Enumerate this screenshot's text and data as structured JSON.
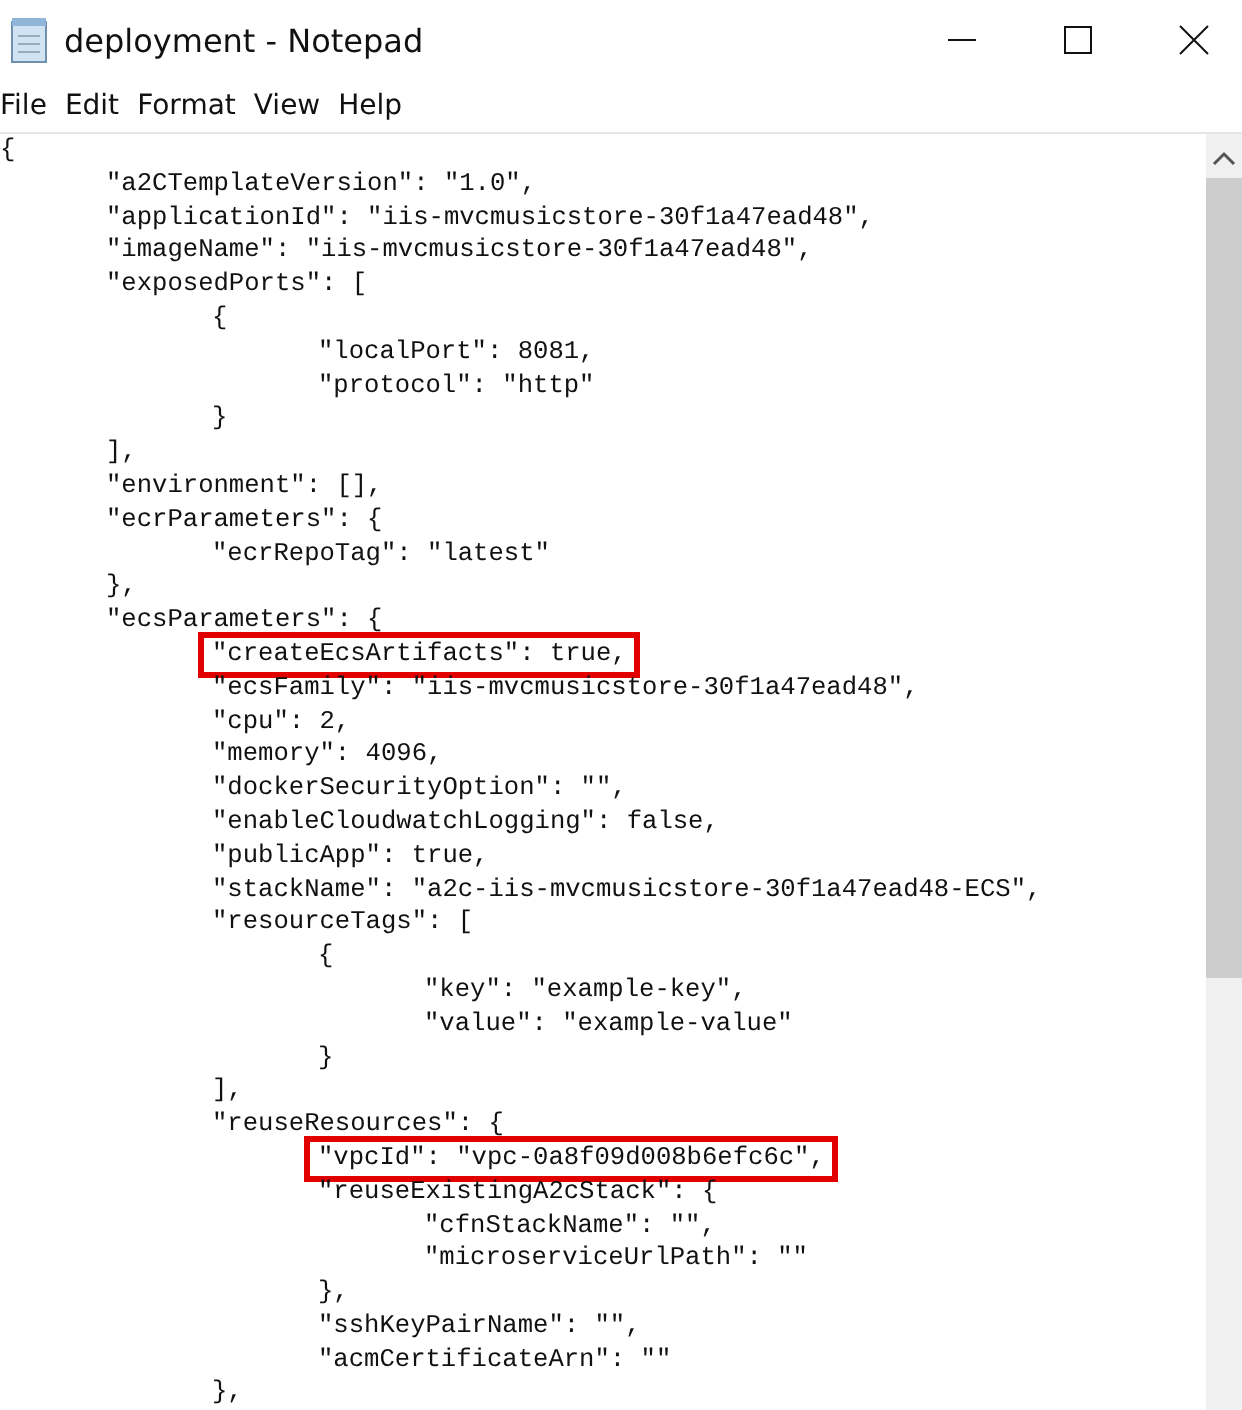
{
  "window": {
    "title": "deployment - Notepad"
  },
  "menu": [
    "File",
    "Edit",
    "Format",
    "View",
    "Help"
  ],
  "lines": [
    {
      "text": "{",
      "highlighted": false
    },
    {
      "text": "\t\"a2CTemplateVersion\": \"1.0\",",
      "highlighted": false
    },
    {
      "text": "\t\"applicationId\": \"iis-mvcmusicstore-30f1a47ead48\",",
      "highlighted": false
    },
    {
      "text": "\t\"imageName\": \"iis-mvcmusicstore-30f1a47ead48\",",
      "highlighted": false
    },
    {
      "text": "\t\"exposedPorts\": [",
      "highlighted": false
    },
    {
      "text": "\t\t{",
      "highlighted": false
    },
    {
      "text": "\t\t\t\"localPort\": 8081,",
      "highlighted": false
    },
    {
      "text": "\t\t\t\"protocol\": \"http\"",
      "highlighted": false
    },
    {
      "text": "\t\t}",
      "highlighted": false
    },
    {
      "text": "\t],",
      "highlighted": false
    },
    {
      "text": "\t\"environment\": [],",
      "highlighted": false
    },
    {
      "text": "\t\"ecrParameters\": {",
      "highlighted": false
    },
    {
      "text": "\t\t\"ecrRepoTag\": \"latest\"",
      "highlighted": false
    },
    {
      "text": "\t},",
      "highlighted": false
    },
    {
      "text": "\t\"ecsParameters\": {",
      "highlighted": false
    },
    {
      "text": "\t\t\"createEcsArtifacts\": true,",
      "highlighted": true
    },
    {
      "text": "\t\t\"ecsFamily\": \"iis-mvcmusicstore-30f1a47ead48\",",
      "highlighted": false
    },
    {
      "text": "\t\t\"cpu\": 2,",
      "highlighted": false
    },
    {
      "text": "\t\t\"memory\": 4096,",
      "highlighted": false
    },
    {
      "text": "\t\t\"dockerSecurityOption\": \"\",",
      "highlighted": false
    },
    {
      "text": "\t\t\"enableCloudwatchLogging\": false,",
      "highlighted": false
    },
    {
      "text": "\t\t\"publicApp\": true,",
      "highlighted": false
    },
    {
      "text": "\t\t\"stackName\": \"a2c-iis-mvcmusicstore-30f1a47ead48-ECS\",",
      "highlighted": false
    },
    {
      "text": "\t\t\"resourceTags\": [",
      "highlighted": false
    },
    {
      "text": "\t\t\t{",
      "highlighted": false
    },
    {
      "text": "\t\t\t\t\"key\": \"example-key\",",
      "highlighted": false
    },
    {
      "text": "\t\t\t\t\"value\": \"example-value\"",
      "highlighted": false
    },
    {
      "text": "\t\t\t}",
      "highlighted": false
    },
    {
      "text": "\t\t],",
      "highlighted": false
    },
    {
      "text": "\t\t\"reuseResources\": {",
      "highlighted": false
    },
    {
      "text": "\t\t\t\"vpcId\": \"vpc-0a8f09d008b6efc6c\",",
      "highlighted": true
    },
    {
      "text": "\t\t\t\"reuseExistingA2cStack\": {",
      "highlighted": false
    },
    {
      "text": "\t\t\t\t\"cfnStackName\": \"\",",
      "highlighted": false
    },
    {
      "text": "\t\t\t\t\"microserviceUrlPath\": \"\"",
      "highlighted": false
    },
    {
      "text": "\t\t\t},",
      "highlighted": false
    },
    {
      "text": "\t\t\t\"sshKeyPairName\": \"\",",
      "highlighted": false
    },
    {
      "text": "\t\t\t\"acmCertificateArn\": \"\"",
      "highlighted": false
    },
    {
      "text": "\t\t},",
      "highlighted": false
    }
  ]
}
